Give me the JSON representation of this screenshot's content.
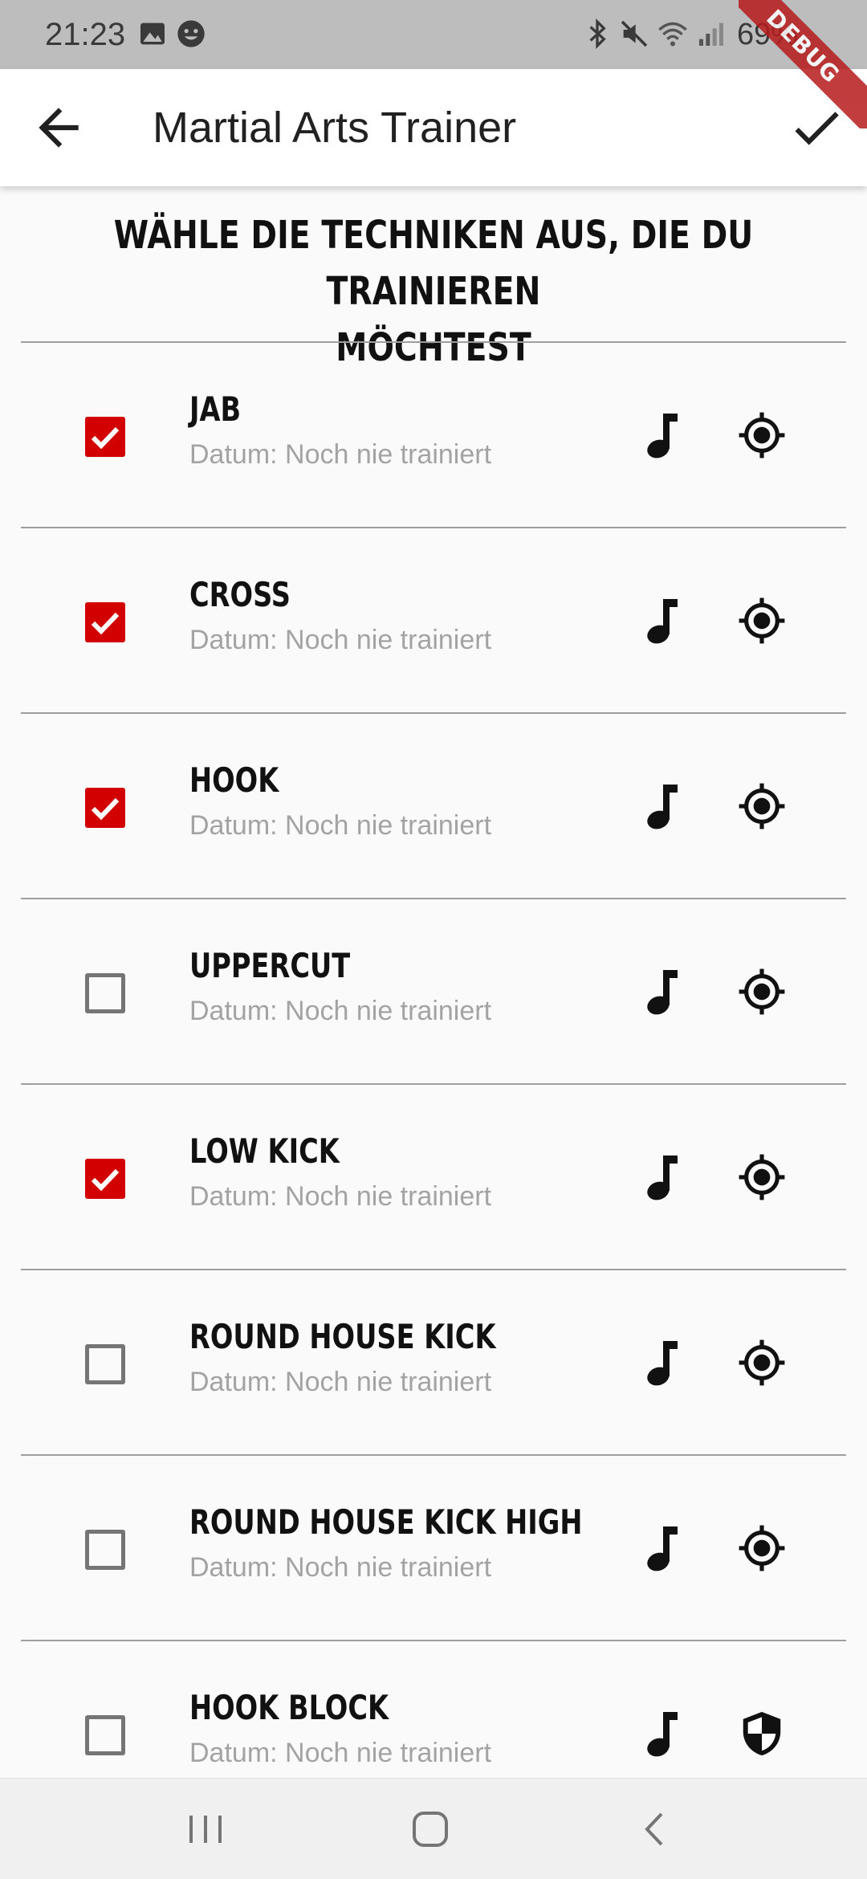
{
  "status_bar": {
    "time": "21:23",
    "battery": "69%",
    "debug_label": "DEBUG"
  },
  "app_bar": {
    "title": "Martial Arts Trainer",
    "back_icon": "arrow-back-icon",
    "confirm_icon": "check-icon"
  },
  "heading": {
    "line1": "WÄHLE DIE TECHNIKEN AUS, DIE DU TRAINIEREN",
    "line2": "MÖCHTEST"
  },
  "techniques": [
    {
      "name": "JAB",
      "subtitle": "Datum: Noch nie trainiert",
      "checked": true,
      "type_icon": "target-icon"
    },
    {
      "name": "CROSS",
      "subtitle": "Datum: Noch nie trainiert",
      "checked": true,
      "type_icon": "target-icon"
    },
    {
      "name": "HOOK",
      "subtitle": "Datum: Noch nie trainiert",
      "checked": true,
      "type_icon": "target-icon"
    },
    {
      "name": "UPPERCUT",
      "subtitle": "Datum: Noch nie trainiert",
      "checked": false,
      "type_icon": "target-icon"
    },
    {
      "name": "LOW KICK",
      "subtitle": "Datum: Noch nie trainiert",
      "checked": true,
      "type_icon": "target-icon"
    },
    {
      "name": "ROUND HOUSE KICK",
      "subtitle": "Datum: Noch nie trainiert",
      "checked": false,
      "type_icon": "target-icon"
    },
    {
      "name": "ROUND HOUSE KICK HIGH",
      "subtitle": "Datum: Noch nie trainiert",
      "checked": false,
      "type_icon": "target-icon"
    },
    {
      "name": "HOOK BLOCK",
      "subtitle": "Datum: Noch nie trainiert",
      "checked": false,
      "type_icon": "shield-icon"
    }
  ],
  "colors": {
    "accent": "#d30000",
    "appbar": "#ffffff",
    "statusbar": "#bdbdbd"
  },
  "nav_bar": {
    "recent_icon": "recent-apps-icon",
    "home_icon": "home-icon",
    "back_icon": "nav-back-icon"
  }
}
